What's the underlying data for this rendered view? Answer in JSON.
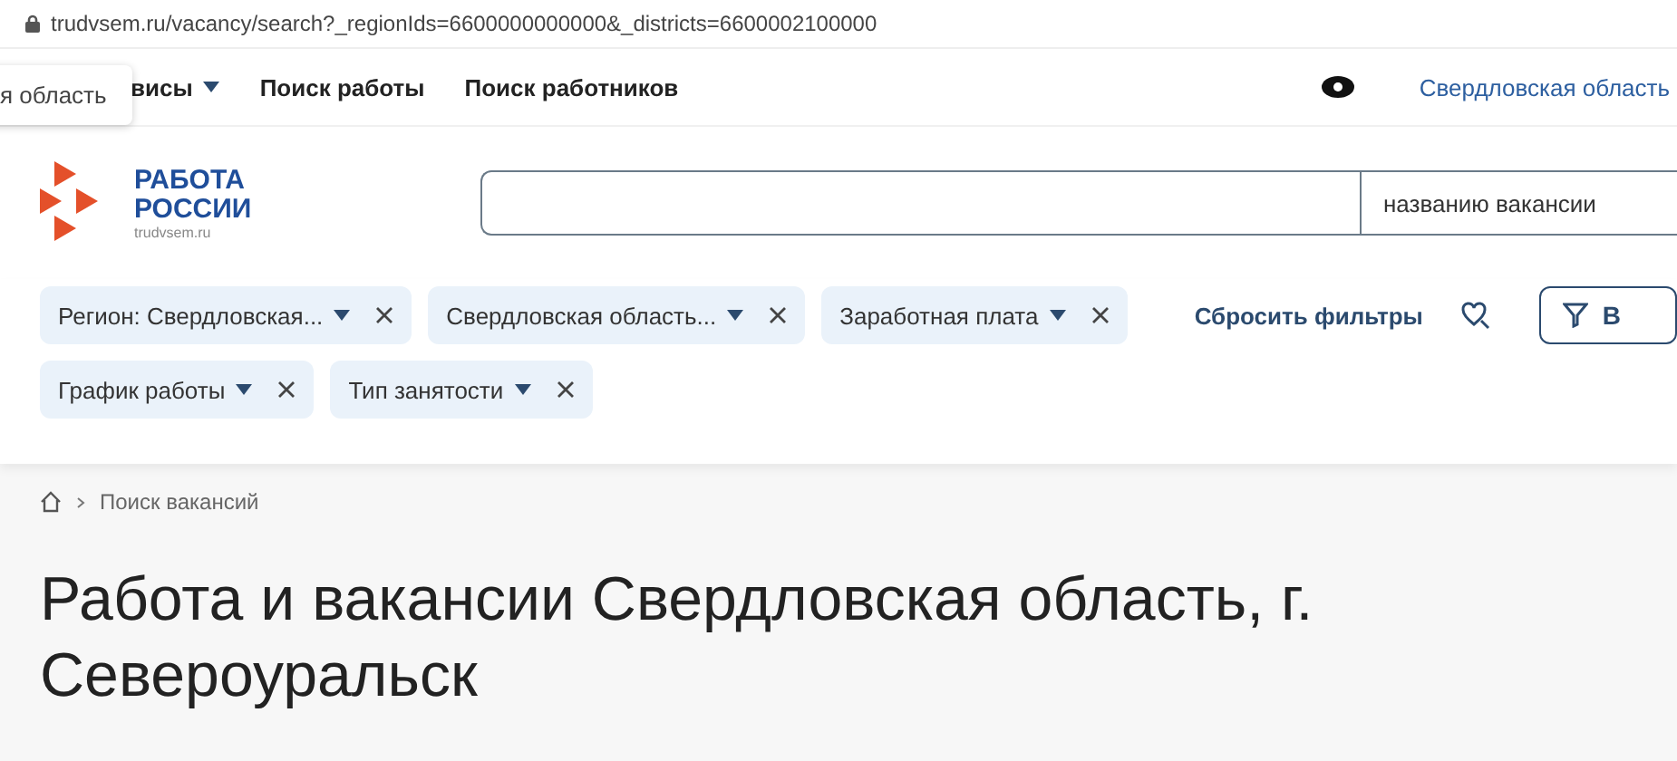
{
  "address_bar": {
    "url": "trudvsem.ru/vacancy/search?_regionIds=6600000000000&_districts=6600002100000"
  },
  "tooltip": {
    "text": "я область"
  },
  "nav": {
    "items": [
      {
        "label": "висы",
        "dropdown": true
      },
      {
        "label": "Поиск работы",
        "dropdown": false
      },
      {
        "label": "Поиск работников",
        "dropdown": false
      }
    ],
    "region": "Свердловская область"
  },
  "logo": {
    "line1": "РАБОТА",
    "line2": "РОССИИ",
    "site": "trudvsem.ru"
  },
  "search": {
    "search_by": "названию вакансии"
  },
  "filters": [
    {
      "label": "Регион: Свердловская..."
    },
    {
      "label": "Свердловская область..."
    },
    {
      "label": "Заработная плата"
    },
    {
      "label": "График работы"
    },
    {
      "label": "Тип занятости"
    }
  ],
  "reset_filters": "Сбросить фильтры",
  "filter_button": "В",
  "breadcrumb": {
    "current": "Поиск вакансий"
  },
  "heading": "Работа и вакансии Свердловская область, г. Североуральск"
}
